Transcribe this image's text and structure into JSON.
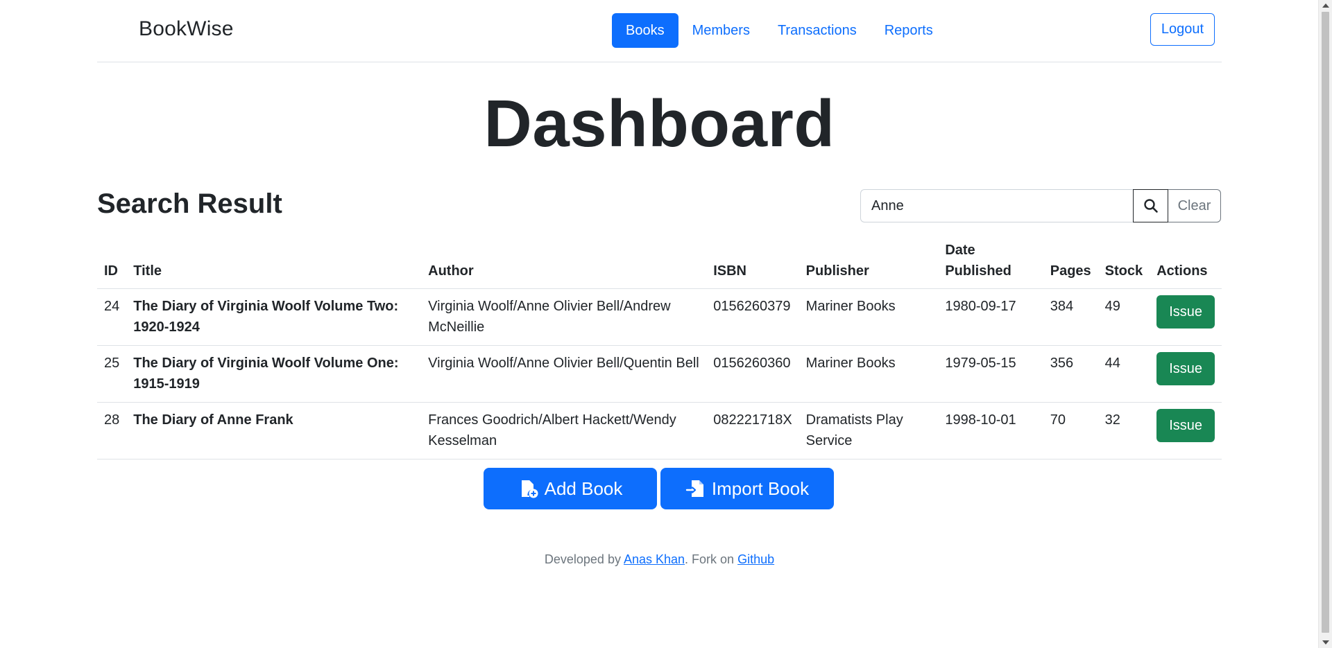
{
  "navbar": {
    "brand": "BookWise",
    "links": [
      {
        "label": "Books",
        "active": true
      },
      {
        "label": "Members",
        "active": false
      },
      {
        "label": "Transactions",
        "active": false
      },
      {
        "label": "Reports",
        "active": false
      }
    ],
    "logout_label": "Logout"
  },
  "page_title": "Dashboard",
  "section_title": "Search Result",
  "search": {
    "value": "Anne",
    "clear_label": "Clear",
    "icon": "search-icon"
  },
  "table": {
    "headers": [
      "ID",
      "Title",
      "Author",
      "ISBN",
      "Publisher",
      "Date Published",
      "Pages",
      "Stock",
      "Actions"
    ],
    "rows": [
      {
        "id": "24",
        "title": "The Diary of Virginia Woolf Volume Two: 1920-1924",
        "author": "Virginia Woolf/Anne Olivier Bell/Andrew McNeillie",
        "isbn": "0156260379",
        "publisher": "Mariner Books",
        "date": "1980-09-17",
        "pages": "384",
        "stock": "49",
        "action": "Issue"
      },
      {
        "id": "25",
        "title": "The Diary of Virginia Woolf Volume One: 1915-1919",
        "author": "Virginia Woolf/Anne Olivier Bell/Quentin Bell",
        "isbn": "0156260360",
        "publisher": "Mariner Books",
        "date": "1979-05-15",
        "pages": "356",
        "stock": "44",
        "action": "Issue"
      },
      {
        "id": "28",
        "title": "The Diary of Anne Frank",
        "author": "Frances Goodrich/Albert Hackett/Wendy Kesselman",
        "isbn": "082221718X",
        "publisher": "Dramatists Play Service",
        "date": "1998-10-01",
        "pages": "70",
        "stock": "32",
        "action": "Issue"
      }
    ]
  },
  "actions": {
    "add_book": "Add Book",
    "import_book": "Import Book"
  },
  "footer": {
    "prefix": "Developed by ",
    "author_link": "Anas Khan",
    "middle": ". Fork on ",
    "github_link": "Github"
  },
  "colors": {
    "primary": "#0d6efd",
    "success": "#198754",
    "text": "#212529",
    "muted": "#6c757d",
    "border": "#dee2e6"
  }
}
